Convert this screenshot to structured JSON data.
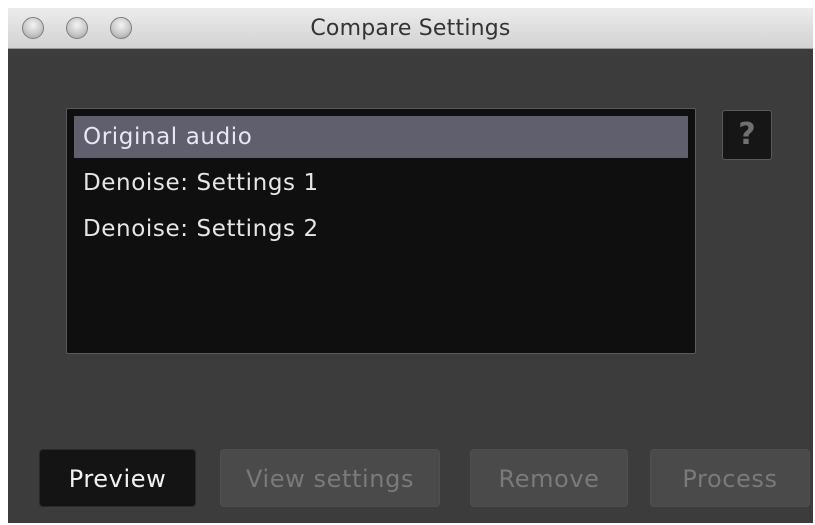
{
  "window": {
    "title": "Compare Settings"
  },
  "titlebar": {
    "buttons": [
      "close",
      "minimize",
      "zoom"
    ]
  },
  "settings_list": {
    "items": [
      {
        "label": "Original audio",
        "selected": true
      },
      {
        "label": "Denoise: Settings 1",
        "selected": false
      },
      {
        "label": "Denoise: Settings 2",
        "selected": false
      }
    ]
  },
  "help": {
    "label": "?"
  },
  "actions": {
    "preview": {
      "label": "Preview",
      "enabled": true
    },
    "view_settings": {
      "label": "View settings",
      "enabled": false
    },
    "remove": {
      "label": "Remove",
      "enabled": false
    },
    "process": {
      "label": "Process",
      "enabled": false
    }
  }
}
